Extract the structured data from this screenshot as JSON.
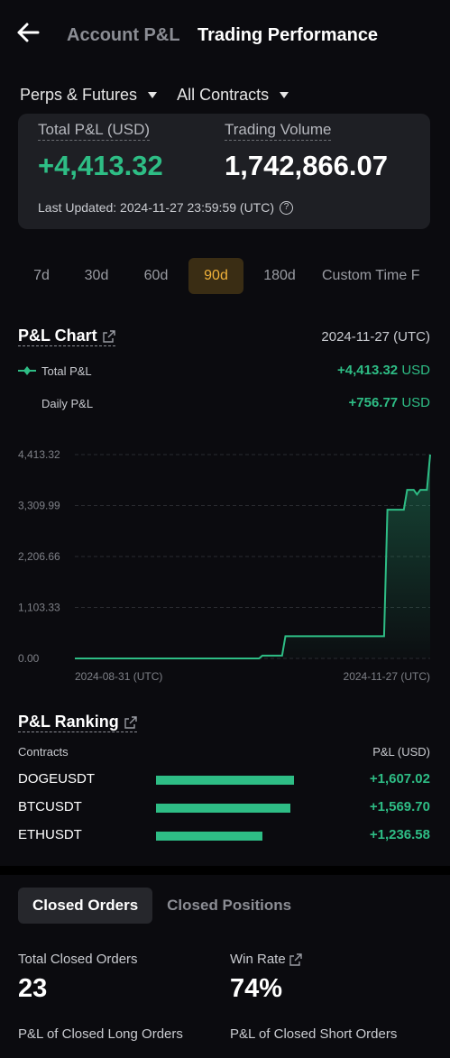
{
  "header": {
    "tab_inactive": "Account P&L",
    "tab_active": "Trading Performance"
  },
  "filters": {
    "product": "Perps & Futures",
    "contracts": "All Contracts"
  },
  "summary": {
    "total_pl_label": "Total P&L (USD)",
    "total_pl_value": "+4,413.32",
    "volume_label": "Trading Volume",
    "volume_value": "1,742,866.07",
    "last_updated": "Last Updated: 2024-11-27 23:59:59 (UTC)"
  },
  "periods": [
    "7d",
    "30d",
    "60d",
    "90d",
    "180d",
    "Custom Time F"
  ],
  "selected_period": "90d",
  "pl_chart": {
    "title": "P&L Chart",
    "date": "2024-11-27 (UTC)",
    "total_label": "Total P&L",
    "total_value": "+4,413.32",
    "daily_label": "Daily P&L",
    "daily_value": "+756.77",
    "unit": "USD"
  },
  "chart_data": {
    "type": "area",
    "y_ticks": [
      "4,413.32",
      "3,309.99",
      "2,206.66",
      "1,103.33",
      "0.00"
    ],
    "ylim": [
      0,
      4413.32
    ],
    "x_labels": [
      "2024-08-31 (UTC)",
      "2024-11-27 (UTC)"
    ],
    "series": [
      {
        "values": [
          0,
          0,
          0,
          0,
          0,
          0,
          0,
          0,
          0,
          0,
          0,
          0,
          0,
          0,
          0,
          0,
          0,
          0,
          0,
          0,
          0,
          0,
          0,
          0,
          0,
          0,
          0,
          0,
          0,
          0,
          0,
          0,
          0,
          0,
          0,
          0,
          0,
          0,
          0,
          0,
          0,
          0,
          0,
          0,
          0,
          0,
          0,
          0,
          0,
          0,
          0,
          0,
          0,
          0,
          0,
          0,
          0,
          60,
          60,
          60,
          60,
          60,
          60,
          60,
          480,
          480,
          480,
          480,
          480,
          480,
          480,
          480,
          480,
          480,
          480,
          480,
          480,
          480,
          480,
          480,
          480,
          480,
          480,
          480,
          480,
          480,
          480,
          480,
          480,
          480,
          480,
          480,
          480,
          480,
          480,
          3220,
          3220,
          3220,
          3220,
          3220,
          3220,
          3650,
          3650,
          3650,
          3550,
          3650,
          3650,
          3650,
          4413.32
        ]
      }
    ],
    "color": "#2ebd85"
  },
  "ranking": {
    "title": "P&L Ranking",
    "col_contracts": "Contracts",
    "col_pl": "P&L (USD)",
    "rows": [
      {
        "name": "DOGEUSDT",
        "value": "+1,607.02",
        "amount": 1607.02
      },
      {
        "name": "BTCUSDT",
        "value": "+1,569.70",
        "amount": 1569.7
      },
      {
        "name": "ETHUSDT",
        "value": "+1,236.58",
        "amount": 1236.58
      }
    ]
  },
  "orders": {
    "tab_active": "Closed Orders",
    "tab_inactive": "Closed Positions",
    "total_label": "Total Closed Orders",
    "total_value": "23",
    "win_label": "Win Rate",
    "win_value": "74%",
    "long_label": "P&L of Closed Long Orders",
    "short_label": "P&L of Closed Short Orders"
  }
}
